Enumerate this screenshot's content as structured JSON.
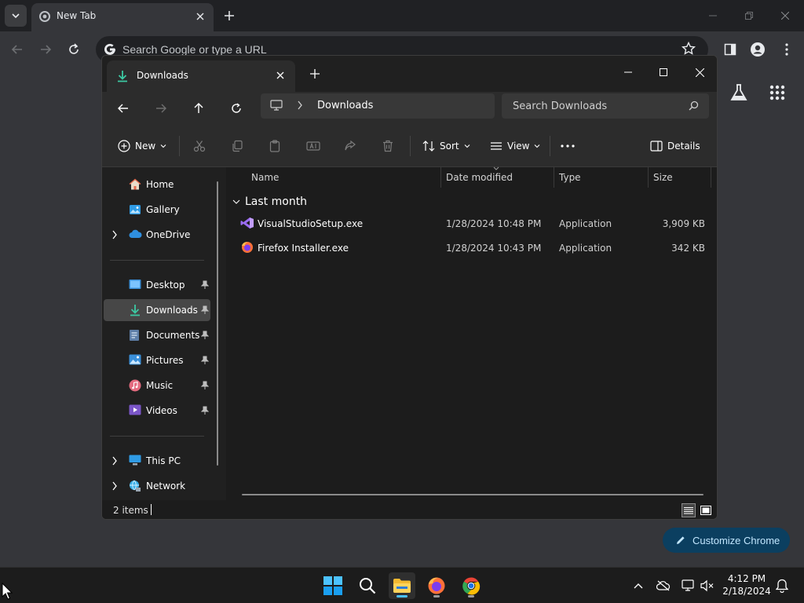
{
  "chrome": {
    "tab_title": "New Tab",
    "omnibox_placeholder": "Search Google or type a URL",
    "customize_label": "Customize Chrome"
  },
  "explorer": {
    "tab_title": "Downloads",
    "address": {
      "location": "Downloads"
    },
    "search_placeholder": "Search Downloads",
    "commands": {
      "new": "New",
      "sort": "Sort",
      "view": "View",
      "details": "Details"
    },
    "sidebar": {
      "home": "Home",
      "gallery": "Gallery",
      "onedrive": "OneDrive",
      "desktop": "Desktop",
      "downloads": "Downloads",
      "documents": "Documents",
      "pictures": "Pictures",
      "music": "Music",
      "videos": "Videos",
      "thispc": "This PC",
      "network": "Network"
    },
    "columns": {
      "name": "Name",
      "date": "Date modified",
      "type": "Type",
      "size": "Size"
    },
    "group": "Last month",
    "files": [
      {
        "name": "VisualStudioSetup.exe",
        "date": "1/28/2024 10:48 PM",
        "type": "Application",
        "size": "3,909 KB"
      },
      {
        "name": "Firefox Installer.exe",
        "date": "1/28/2024 10:43 PM",
        "type": "Application",
        "size": "342 KB"
      }
    ],
    "status": "2 items"
  },
  "taskbar": {
    "time": "4:12 PM",
    "date": "2/18/2024"
  },
  "colors": {
    "accent": "#4cc2ff",
    "chrome_frame": "#202124",
    "explorer_bg": "#202020",
    "customize_bg": "#0b3f60"
  }
}
